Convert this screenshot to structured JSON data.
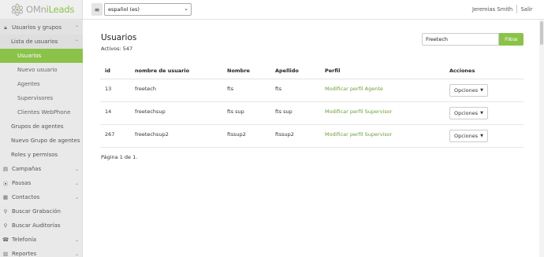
{
  "brand": {
    "prefix": "OMn",
    "accent": "iLeads",
    "color": "#8bc34a"
  },
  "topbar": {
    "menu_icon": "hamburger-icon",
    "language": "español (es)",
    "user": "Jeremias Smith",
    "logout": "Salir"
  },
  "sidebar": {
    "usuarios": {
      "icon": "lock-icon",
      "label": "Usuarios y grupos"
    },
    "lista": {
      "label": "Lista de usuarios"
    },
    "sub": {
      "usuarios": "Usuarios",
      "nuevo": "Nuevo usuario",
      "agentes": "Agentes",
      "supervisores": "Supervisores",
      "webphone": "Clientes WebPhone"
    },
    "grupos": "Grupos de agentes",
    "nuevo_grupo": "Nuevo Grupo de agentes",
    "roles": "Roles y permisos",
    "campanas": {
      "icon": "folder-icon",
      "label": "Campañas"
    },
    "pausas": {
      "icon": "pause-icon",
      "label": "Pausas"
    },
    "contactos": {
      "icon": "address-book-icon",
      "label": "Contactos"
    },
    "grabacion": {
      "icon": "search-icon",
      "label": "Buscar Grabación"
    },
    "auditorias": {
      "icon": "search-icon",
      "label": "Buscar Auditorías"
    },
    "telefonia": {
      "icon": "phone-icon",
      "label": "Telefonía"
    },
    "reportes": {
      "icon": "chart-icon",
      "label": "Reportes"
    }
  },
  "main": {
    "title": "Usuarios",
    "active_count": "Activos: 547",
    "search_value": "Freetech",
    "filter_label": "Filtrar",
    "columns": [
      "id",
      "nombre de usuario",
      "Nombre",
      "Apellido",
      "Perfil",
      "Acciones"
    ],
    "rows": [
      {
        "id": "13",
        "username": "freetech",
        "nombre": "fts",
        "apellido": "fts",
        "perfil": "Modificar perfil Agente",
        "acciones": "Opciones"
      },
      {
        "id": "14",
        "username": "freetechsup",
        "nombre": "fts sup",
        "apellido": "fts sup",
        "perfil": "Modificar perfil Supervisor",
        "acciones": "Opciones"
      },
      {
        "id": "267",
        "username": "freetechsup2",
        "nombre": "ftssup2",
        "apellido": "ftssup2",
        "perfil": "Modificar perfil Supervisor",
        "acciones": "Opciones"
      }
    ],
    "pagination": "Página 1 de 1."
  }
}
